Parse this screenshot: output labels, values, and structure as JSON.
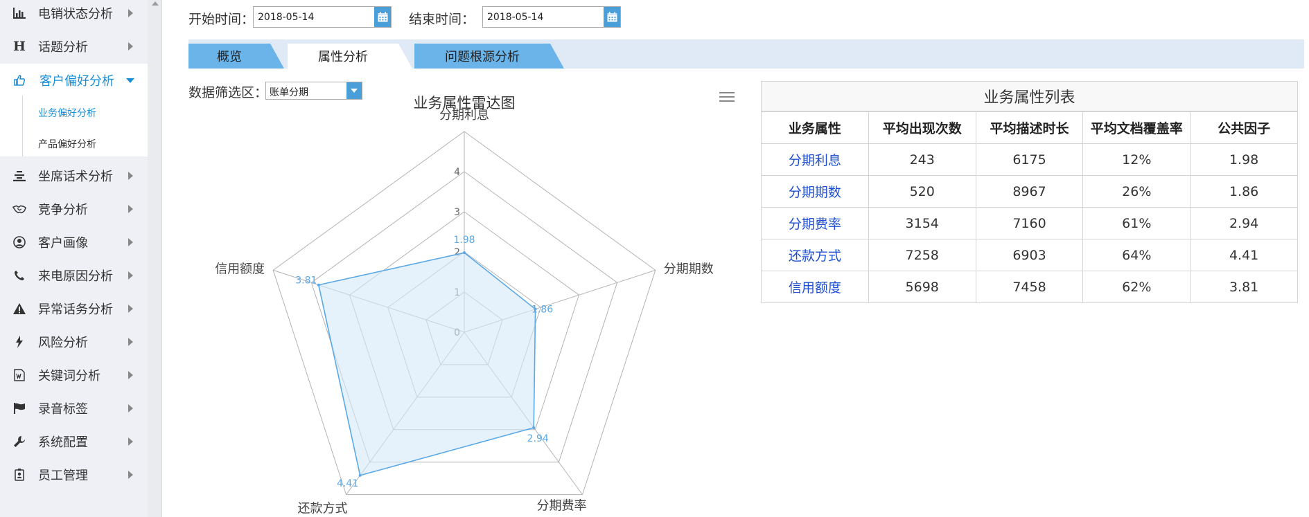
{
  "sidebar": {
    "items": [
      {
        "label": "电销状态分析",
        "icon": "bar-chart-icon"
      },
      {
        "label": "话题分析",
        "icon": "heading-icon"
      },
      {
        "label": "客户偏好分析",
        "icon": "thumbs-up-icon",
        "active": true
      },
      {
        "label": "坐席话术分析",
        "icon": "align-center-icon"
      },
      {
        "label": "竞争分析",
        "icon": "handshake-icon"
      },
      {
        "label": "客户画像",
        "icon": "user-circle-icon"
      },
      {
        "label": "来电原因分析",
        "icon": "phone-icon"
      },
      {
        "label": "异常话务分析",
        "icon": "warning-icon"
      },
      {
        "label": "风险分析",
        "icon": "bolt-icon"
      },
      {
        "label": "关键词分析",
        "icon": "word-doc-icon"
      },
      {
        "label": "录音标签",
        "icon": "flag-icon"
      },
      {
        "label": "系统配置",
        "icon": "wrench-icon"
      },
      {
        "label": "员工管理",
        "icon": "id-badge-icon"
      }
    ],
    "submenu": [
      {
        "label": "业务偏好分析",
        "active": true
      },
      {
        "label": "产品偏好分析",
        "active": false
      }
    ]
  },
  "filters": {
    "start_label": "开始时间：",
    "start_value": "2018-05-14",
    "end_label": "结束时间：",
    "end_value": "2018-05-14"
  },
  "tabs": [
    {
      "label": "概览",
      "active": false
    },
    {
      "label": "属性分析",
      "active": true
    },
    {
      "label": "问题根源分析",
      "active": false
    }
  ],
  "data_filter": {
    "label": "数据筛选区：",
    "value": "账单分期"
  },
  "chart_data": {
    "type": "radar",
    "title": "业务属性雷达图",
    "indicators": [
      "分期利息",
      "分期期数",
      "分期费率",
      "还款方式",
      "信用额度"
    ],
    "values": [
      1.98,
      1.86,
      2.94,
      4.41,
      3.81
    ],
    "rmax": 5,
    "ticks": [
      "0",
      "1",
      "2",
      "3",
      "4"
    ],
    "colors": {
      "line": "#5aa9e6",
      "fill": "#d6e9f8",
      "grid": "#b3b3b3",
      "label": "#5aa9e6"
    }
  },
  "table": {
    "title": "业务属性列表",
    "headers": [
      "业务属性",
      "平均出现次数",
      "平均描述时长",
      "平均文档覆盖率",
      "公共因子"
    ],
    "rows": [
      [
        "分期利息",
        "243",
        "6175",
        "12%",
        "1.98"
      ],
      [
        "分期期数",
        "520",
        "8967",
        "26%",
        "1.86"
      ],
      [
        "分期费率",
        "3154",
        "7160",
        "61%",
        "2.94"
      ],
      [
        "还款方式",
        "7258",
        "6903",
        "64%",
        "4.41"
      ],
      [
        "信用额度",
        "5698",
        "7458",
        "62%",
        "3.81"
      ]
    ]
  },
  "colors": {
    "accent": "#1a8fd8",
    "tab_blue": "#6ab4ea",
    "tabbar_bg": "#dfeaf6",
    "link": "#1f4fcf"
  }
}
